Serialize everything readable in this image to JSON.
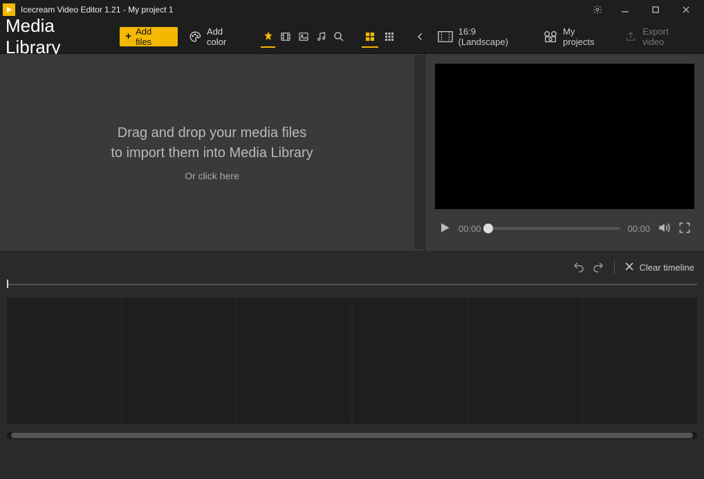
{
  "titlebar": {
    "title": "Icecream Video Editor 1.21 - My project 1"
  },
  "toolbar": {
    "media_library": "Media Library",
    "add_files": "Add files",
    "add_color": "Add color",
    "aspect_ratio": "16:9 (Landscape)",
    "my_projects": "My projects",
    "export_video": "Export video"
  },
  "library": {
    "drop_line1": "Drag and drop your media files",
    "drop_line2": "to import them into Media Library",
    "or_text": "Or ",
    "click_here": "click here"
  },
  "player": {
    "current_time": "00:00",
    "duration": "00:00"
  },
  "timeline": {
    "clear": "Clear timeline"
  }
}
